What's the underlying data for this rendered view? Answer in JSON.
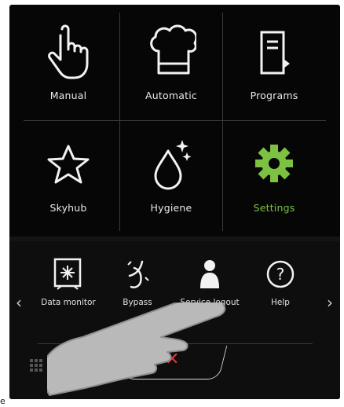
{
  "grid_tiles": [
    {
      "label": "Manual",
      "icon": "hand-pointer-icon"
    },
    {
      "label": "Automatic",
      "icon": "chef-hat-icon"
    },
    {
      "label": "Programs",
      "icon": "book-icon"
    },
    {
      "label": "Skyhub",
      "icon": "star-icon"
    },
    {
      "label": "Hygiene",
      "icon": "droplet-sparkle-icon"
    },
    {
      "label": "Settings",
      "icon": "gear-icon",
      "active": true
    }
  ],
  "strip_items": [
    {
      "label": "Data monitor",
      "icon": "snowflake-box-icon"
    },
    {
      "label": "Bypass",
      "icon": "bypass-icon"
    },
    {
      "label": "Service logout",
      "icon": "person-icon"
    },
    {
      "label": "Help",
      "icon": "help-icon"
    }
  ],
  "nav": {
    "prev": "‹",
    "next": "›"
  },
  "close_label": "✕",
  "caption": "e",
  "colors": {
    "accent": "#7cc142",
    "close": "#e2383a",
    "background": "#060606",
    "text": "#e8e8e8"
  }
}
